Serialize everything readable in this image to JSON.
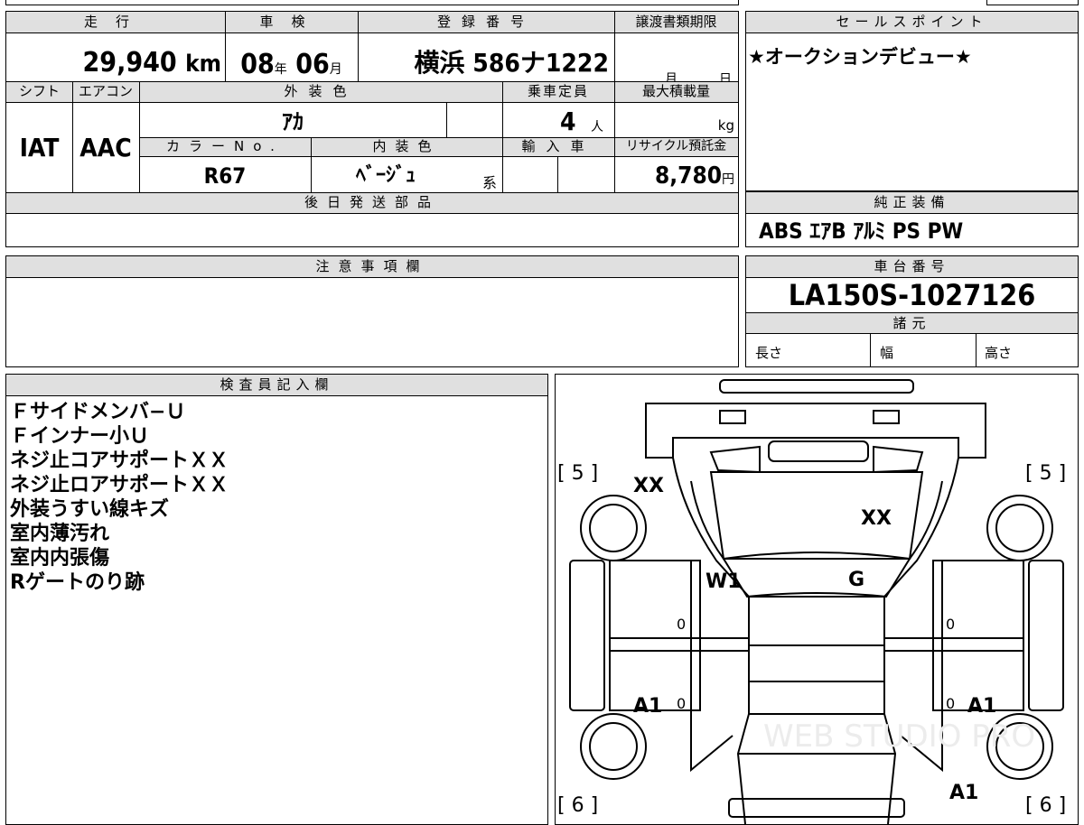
{
  "main": {
    "mileage_label": "走行",
    "mileage_value": "29,940",
    "mileage_unit": "km",
    "shaken_label": "車検",
    "shaken_year": "08",
    "shaken_year_unit": "年",
    "shaken_month": "06",
    "shaken_month_unit": "月",
    "reg_label": "登録番号",
    "reg_value": "横浜 586ナ1222",
    "transfer_label": "譲渡書類期限",
    "transfer_month_unit": "月",
    "transfer_day_unit": "日",
    "shift_label": "シフト",
    "shift_value": "IAT",
    "ac_label": "エアコン",
    "ac_value": "AAC",
    "ext_color_label": "外装色",
    "ext_color_value": "ｱｶ",
    "capacity_label": "乗車定員",
    "capacity_value": "4",
    "capacity_unit": "人",
    "maxload_label": "最大積載量",
    "maxload_unit": "kg",
    "colorno_label": "カラーNo.",
    "colorno_value": "R67",
    "int_color_label": "内装色",
    "int_color_value": "ﾍﾞｰｼﾞｭ",
    "int_color_suffix": "系",
    "import_label": "輸入車",
    "recycle_label": "リサイクル預託金",
    "recycle_value": "8,780",
    "recycle_unit": "円",
    "later_parts_label": "後日発送部品"
  },
  "sales": {
    "label": "セールスポイント",
    "text": "★オークションデビュー★"
  },
  "equipment": {
    "label": "純正装備",
    "text": "ABS ｴｱB ｱﾙﾐ PS PW"
  },
  "caution": {
    "label": "注意事項欄"
  },
  "chassis": {
    "label": "車台番号",
    "value": "LA150S-1027126",
    "spec_label": "諸元",
    "length_label": "長さ",
    "width_label": "幅",
    "height_label": "高さ"
  },
  "inspector": {
    "label": "検査員記入欄",
    "notes": [
      "Ｆサイドメンバ−Ｕ",
      "Ｆインナー小Ｕ",
      "ネジ止コアサポートＸＸ",
      "ネジ止ロアサポートＸＸ",
      "外装うすい線キズ",
      "室内薄汚れ",
      "室内内張傷",
      "Rゲートのり跡"
    ]
  },
  "diagram": {
    "tire_tl": "[ 5 ]",
    "tire_tr": "[ 5 ]",
    "tire_bl": "[ 6 ]",
    "tire_br": "[ 6 ]",
    "mark_xx1": "XX",
    "mark_xx2": "XX",
    "mark_w1": "W1",
    "mark_g": "G",
    "mark_a1_l": "A1",
    "mark_a1_r": "A1",
    "mark_a1_b": "A1",
    "zero1": "0",
    "zero2": "0",
    "zero3": "0",
    "zero4": "0",
    "watermark": "WEB STUDIO PRO"
  }
}
